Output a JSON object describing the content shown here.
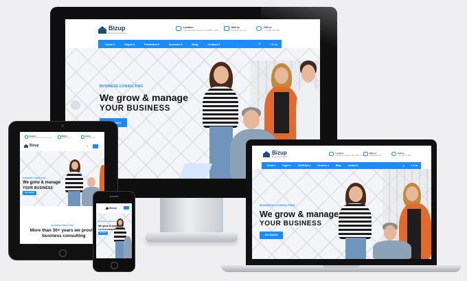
{
  "brand": {
    "name": "Bizup",
    "tagline": "Business & Finance"
  },
  "header": {
    "location_label": "Location",
    "location_value": "136 Harrison Avenue, NY 10001, USA",
    "mail_label": "Mail us",
    "mail_value": "info@bizup.com",
    "call_label": "Call us",
    "call_value": "+1 (234) 567 890"
  },
  "nav": {
    "items": [
      "Home ▾",
      "Pages ▾",
      "Portfolios ▾",
      "Services ▾",
      "Blog",
      "Contact ▾"
    ]
  },
  "hero": {
    "tag": "BUSINESS CONSULTING",
    "headline": "We grow & manage",
    "subheadline": "YOUR BUSINESS",
    "cta": "Get Started"
  },
  "tablet": {
    "headline2": "More than 30+ years we provide business consulting"
  },
  "colors": {
    "accent": "#1a8cff",
    "brand": "#1e3466",
    "device": "#111111"
  }
}
